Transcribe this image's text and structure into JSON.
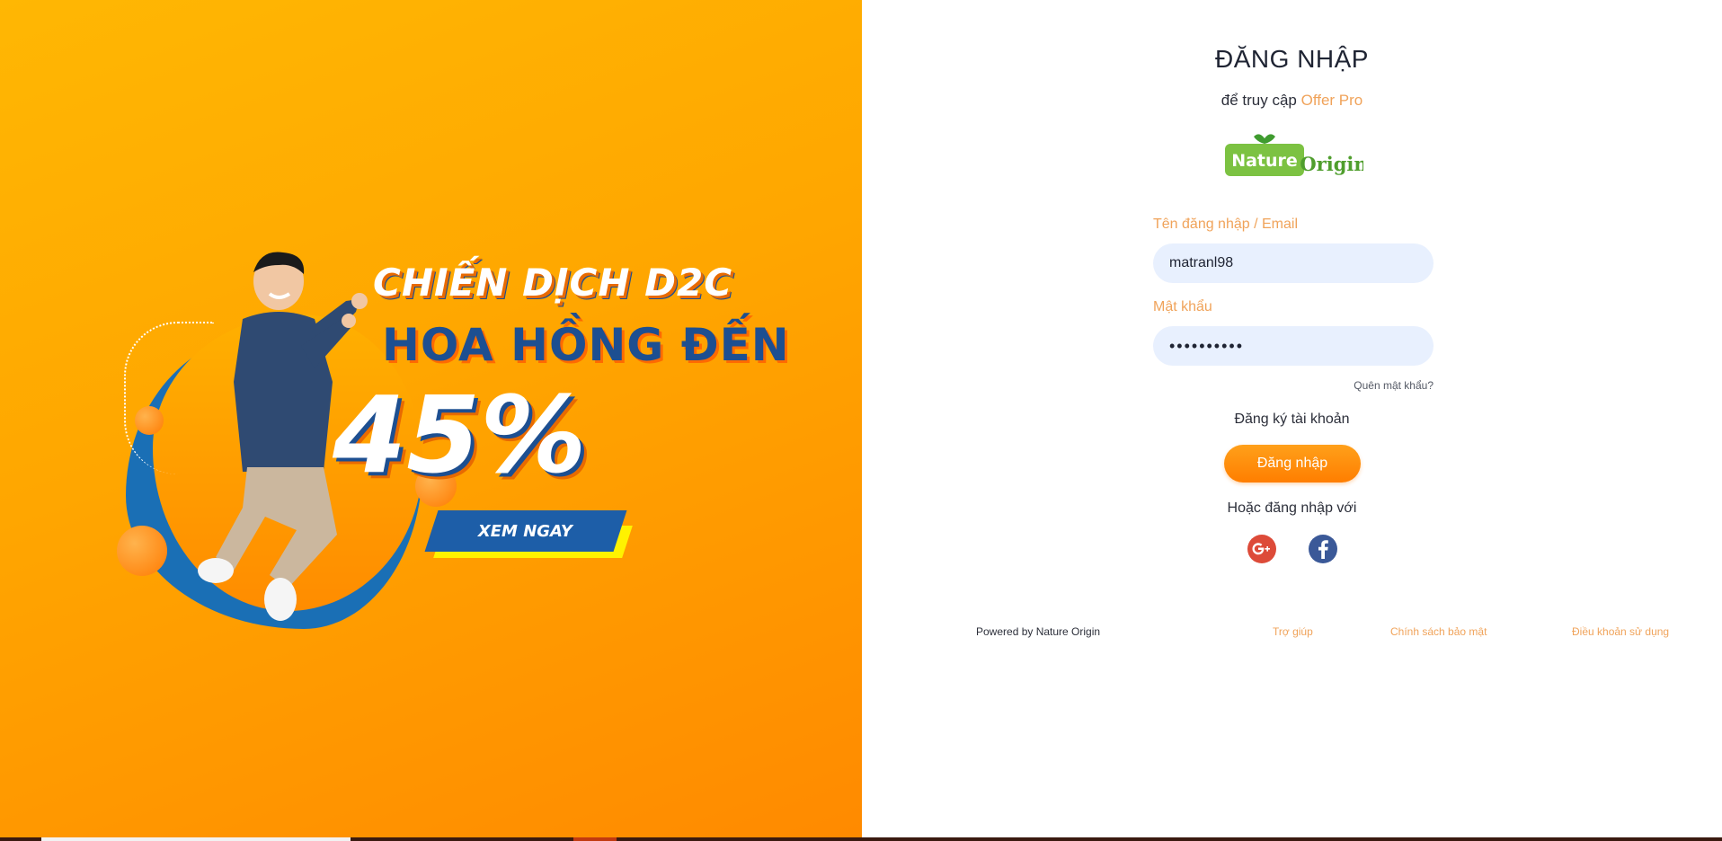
{
  "promo": {
    "headline_line1": "CHIẾN DỊCH D2C",
    "headline_line2": "HOA HỒNG ĐẾN",
    "percent": "45%",
    "cta_label": "XEM NGAY",
    "colors": {
      "bg_start": "#ffb703",
      "bg_end": "#ff8a00",
      "accent_blue": "#1d4f91"
    }
  },
  "login": {
    "title": "ĐĂNG NHẬP",
    "subtitle_prefix": "để truy cập",
    "subtitle_brand": "Offer Pro",
    "logo": {
      "word1": "Nature",
      "word2": "Origin"
    },
    "username": {
      "label": "Tên đăng nhập / Email",
      "value": "matranl98"
    },
    "password": {
      "label": "Mật khẩu",
      "value": "••••••••••"
    },
    "forgot_label": "Quên mật khẩu?",
    "register_label": "Đăng ký tài khoản",
    "submit_label": "Đăng nhập",
    "or_label": "Hoặc đăng nhập với",
    "social": [
      {
        "name": "google",
        "icon": "google-plus-icon",
        "color": "#dd4b39"
      },
      {
        "name": "facebook",
        "icon": "facebook-icon",
        "color": "#3b5998"
      }
    ],
    "accent_color": "#f0a35a"
  },
  "footer": {
    "powered": "Powered by Nature Origin",
    "help": "Trợ giúp",
    "privacy": "Chính sách bảo mật",
    "terms": "Điều khoản sử dụng"
  }
}
